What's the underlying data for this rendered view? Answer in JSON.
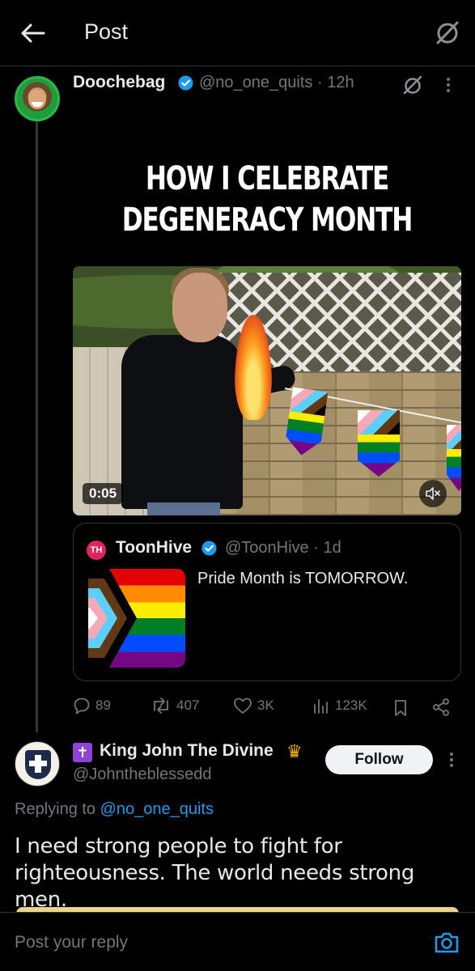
{
  "header": {
    "title": "Post",
    "back_icon": "arrow-left-icon",
    "grok_icon": "grok-icon"
  },
  "post": {
    "author_name": "Doochebag",
    "handle": "@no_one_quits",
    "time": "12h",
    "meme_caption": "HOW I CELEBRATE DEGENERACY MONTH",
    "video_duration": "0:05",
    "quote": {
      "author_name": "ToonHive",
      "avatar_text": "TH",
      "handle": "@ToonHive",
      "time": "1d",
      "text": "Pride Month is TOMORROW."
    },
    "stats": {
      "replies": "89",
      "reposts": "407",
      "likes": "3K",
      "views": "123K"
    }
  },
  "reply": {
    "author_name": "King John The Divine",
    "handle": "@Johntheblessedd",
    "follow_label": "Follow",
    "replying_prefix": "Replying to",
    "replying_to": "@no_one_quits",
    "text": "I need strong people to fight for righteousness. The world needs strong men."
  },
  "composer": {
    "placeholder": "Post your reply"
  },
  "colors": {
    "accent": "#1d9bf0",
    "muted": "#71767b",
    "text": "#e7e9ea",
    "background": "#000000"
  }
}
